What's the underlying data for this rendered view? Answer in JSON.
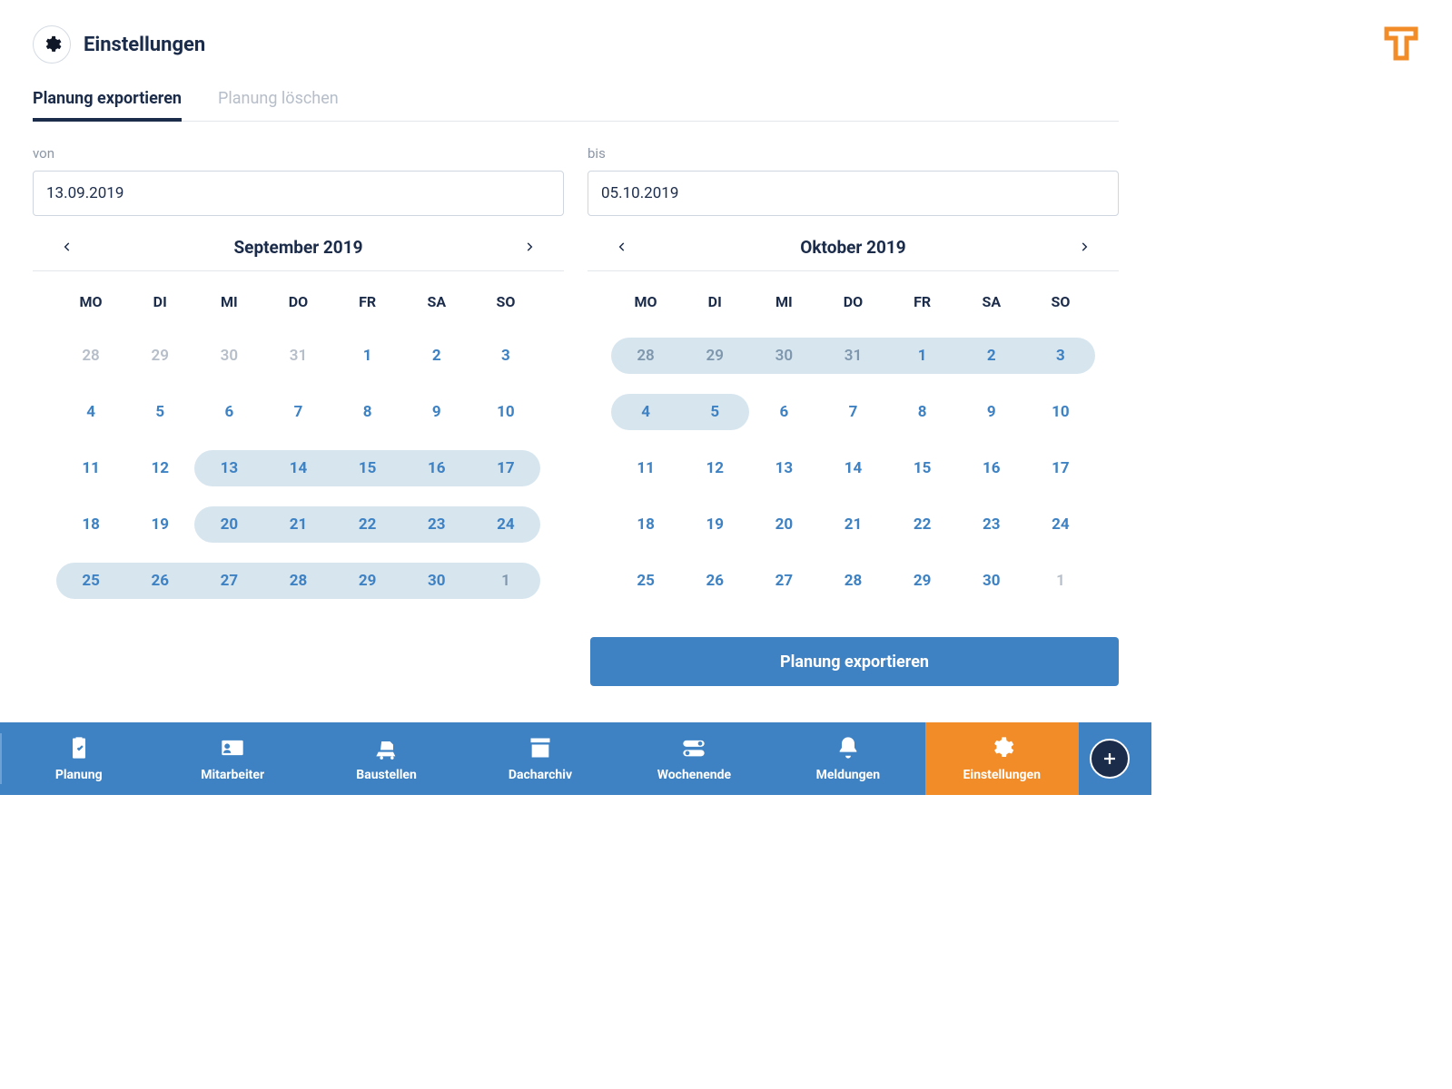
{
  "header": {
    "title": "Einstellungen"
  },
  "tabs": {
    "export": "Planung exportieren",
    "delete": "Planung löschen"
  },
  "range": {
    "from_label": "von",
    "to_label": "bis",
    "from_value": "13.09.2019",
    "to_value": "05.10.2019"
  },
  "calendars": {
    "dow": [
      "MO",
      "DI",
      "MI",
      "DO",
      "FR",
      "SA",
      "SO"
    ],
    "left": {
      "month": "September 2019",
      "weeks": [
        {
          "sel": null,
          "days": [
            {
              "n": "28",
              "other": true
            },
            {
              "n": "29",
              "other": true
            },
            {
              "n": "30",
              "other": true
            },
            {
              "n": "31",
              "other": true
            },
            {
              "n": "1"
            },
            {
              "n": "2"
            },
            {
              "n": "3"
            }
          ]
        },
        {
          "sel": null,
          "days": [
            {
              "n": "4"
            },
            {
              "n": "5"
            },
            {
              "n": "6"
            },
            {
              "n": "7"
            },
            {
              "n": "8"
            },
            {
              "n": "9"
            },
            {
              "n": "10"
            }
          ]
        },
        {
          "sel": [
            2,
            6
          ],
          "days": [
            {
              "n": "11"
            },
            {
              "n": "12"
            },
            {
              "n": "13"
            },
            {
              "n": "14"
            },
            {
              "n": "15"
            },
            {
              "n": "16"
            },
            {
              "n": "17"
            }
          ]
        },
        {
          "sel": [
            2,
            6
          ],
          "days": [
            {
              "n": "18"
            },
            {
              "n": "19"
            },
            {
              "n": "20"
            },
            {
              "n": "21"
            },
            {
              "n": "22"
            },
            {
              "n": "23"
            },
            {
              "n": "24"
            }
          ]
        },
        {
          "sel": [
            0,
            6
          ],
          "days": [
            {
              "n": "25"
            },
            {
              "n": "26"
            },
            {
              "n": "27"
            },
            {
              "n": "28"
            },
            {
              "n": "29"
            },
            {
              "n": "30"
            },
            {
              "n": "1",
              "other": true,
              "selOther": true
            }
          ]
        }
      ]
    },
    "right": {
      "month": "Oktober 2019",
      "weeks": [
        {
          "sel": [
            0,
            6
          ],
          "days": [
            {
              "n": "28",
              "other": true,
              "selOther": true
            },
            {
              "n": "29",
              "other": true,
              "selOther": true
            },
            {
              "n": "30",
              "other": true,
              "selOther": true
            },
            {
              "n": "31",
              "other": true,
              "selOther": true
            },
            {
              "n": "1"
            },
            {
              "n": "2"
            },
            {
              "n": "3"
            }
          ]
        },
        {
          "sel": [
            0,
            1
          ],
          "days": [
            {
              "n": "4"
            },
            {
              "n": "5"
            },
            {
              "n": "6"
            },
            {
              "n": "7"
            },
            {
              "n": "8"
            },
            {
              "n": "9"
            },
            {
              "n": "10"
            }
          ]
        },
        {
          "sel": null,
          "days": [
            {
              "n": "11"
            },
            {
              "n": "12"
            },
            {
              "n": "13"
            },
            {
              "n": "14"
            },
            {
              "n": "15"
            },
            {
              "n": "16"
            },
            {
              "n": "17"
            }
          ]
        },
        {
          "sel": null,
          "days": [
            {
              "n": "18"
            },
            {
              "n": "19"
            },
            {
              "n": "20"
            },
            {
              "n": "21"
            },
            {
              "n": "22"
            },
            {
              "n": "23"
            },
            {
              "n": "24"
            }
          ]
        },
        {
          "sel": null,
          "days": [
            {
              "n": "25"
            },
            {
              "n": "26"
            },
            {
              "n": "27"
            },
            {
              "n": "28"
            },
            {
              "n": "29"
            },
            {
              "n": "30"
            },
            {
              "n": "1",
              "other": true
            }
          ]
        }
      ]
    }
  },
  "action": {
    "export_button": "Planung exportieren"
  },
  "nav": {
    "items": [
      {
        "label": "Planung",
        "icon": "clipboard-check"
      },
      {
        "label": "Mitarbeiter",
        "icon": "id-card"
      },
      {
        "label": "Baustellen",
        "icon": "mixer"
      },
      {
        "label": "Dacharchiv",
        "icon": "archive"
      },
      {
        "label": "Wochenende",
        "icon": "toggle"
      },
      {
        "label": "Meldungen",
        "icon": "bell"
      },
      {
        "label": "Einstellungen",
        "icon": "gear",
        "active": true
      }
    ]
  },
  "colors": {
    "primary_blue": "#3e82c4",
    "accent_orange": "#f28c28",
    "dark_navy": "#1b2b4a",
    "selection": "#d7e5ef"
  }
}
